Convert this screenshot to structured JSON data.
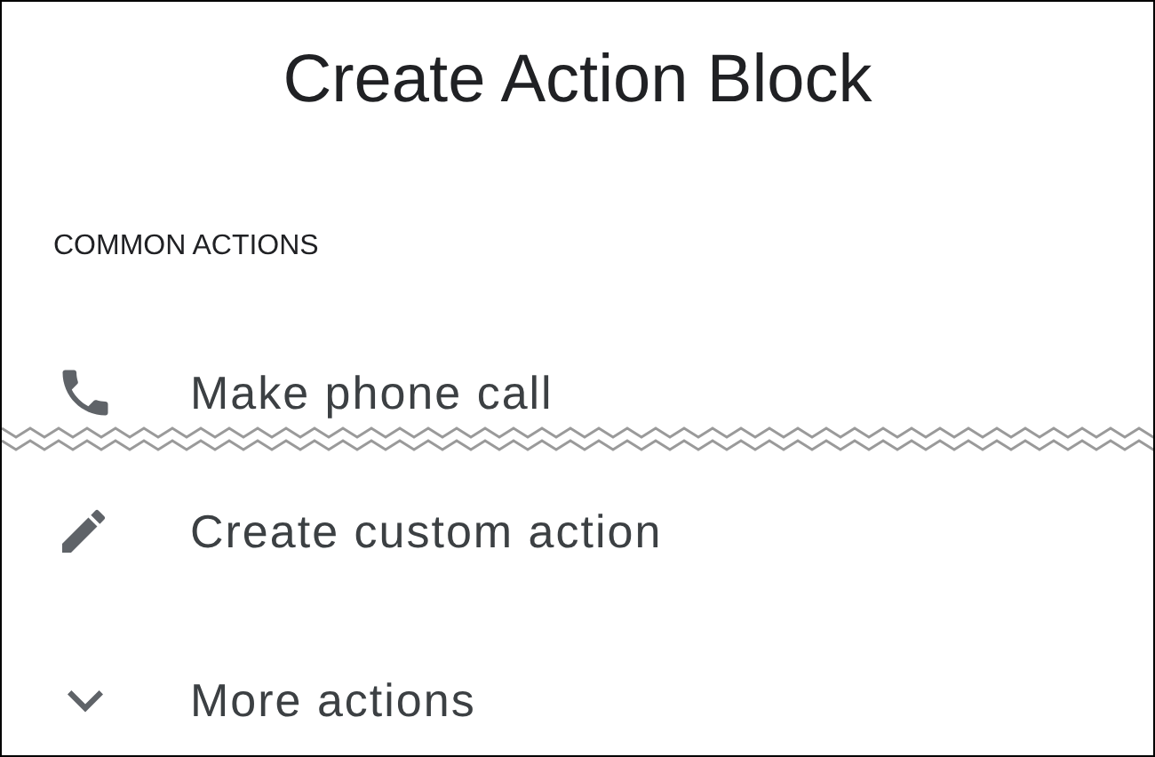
{
  "title": "Create Action Block",
  "section": {
    "label": "COMMON ACTIONS"
  },
  "actions": [
    {
      "kind": "phone",
      "label": "Make phone call"
    },
    {
      "kind": "edit",
      "label": "Create custom action"
    },
    {
      "kind": "expand",
      "label": "More actions"
    }
  ]
}
